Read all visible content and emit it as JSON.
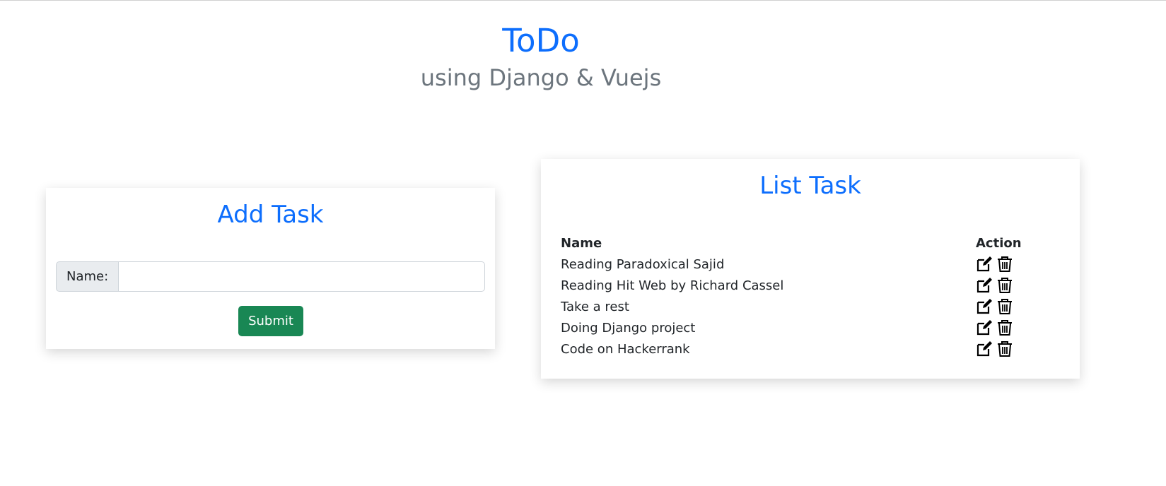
{
  "header": {
    "title": "ToDo",
    "subtitle": "using Django & Vuejs"
  },
  "add_task": {
    "title": "Add Task",
    "name_label": "Name:",
    "name_value": "",
    "name_placeholder": "",
    "submit_label": "Submit"
  },
  "list_task": {
    "title": "List Task",
    "columns": [
      "Name",
      "Action"
    ],
    "rows": [
      {
        "name": "Reading Paradoxical Sajid"
      },
      {
        "name": "Reading Hit Web by Richard Cassel"
      },
      {
        "name": "Take a rest"
      },
      {
        "name": "Doing Django project"
      },
      {
        "name": "Code on Hackerrank"
      }
    ],
    "action_icons": [
      "edit-icon",
      "trash-icon"
    ]
  },
  "colors": {
    "accent": "#0d6efd",
    "muted": "#6c757d",
    "success": "#198754"
  }
}
